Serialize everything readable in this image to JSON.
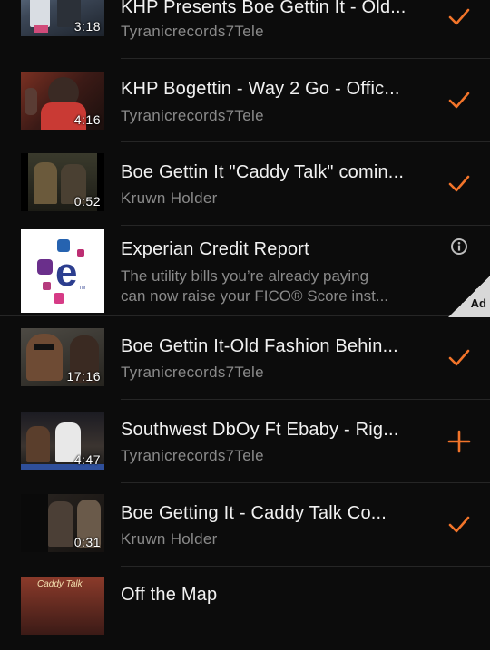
{
  "accent_color": "#f2742a",
  "videos": [
    {
      "title": "KHP Presents Boe Gettin It - Old...",
      "channel": "Tyranicrecords7Tele",
      "duration": "3:18",
      "action_icon": "checkmark-icon"
    },
    {
      "title": "KHP Bogettin - Way 2 Go - Offic...",
      "channel": "Tyranicrecords7Tele",
      "duration": "4:16",
      "action_icon": "checkmark-icon"
    },
    {
      "title": "Boe Gettin It \"Caddy Talk\" comin...",
      "channel": "Kruwn Holder",
      "duration": "0:52",
      "action_icon": "checkmark-icon"
    },
    {
      "title": "Boe Gettin It-Old Fashion Behin...",
      "channel": "Tyranicrecords7Tele",
      "duration": "17:16",
      "action_icon": "checkmark-icon"
    },
    {
      "title": "Southwest DbOy Ft  Ebaby - Rig...",
      "channel": "Tyranicrecords7Tele",
      "duration": "4:47",
      "action_icon": "plus-icon"
    },
    {
      "title": "Boe Getting It  - Caddy Talk Co...",
      "channel": "Kruwn Holder",
      "duration": "0:31",
      "action_icon": "checkmark-icon"
    },
    {
      "title": "Off the Map",
      "channel": "",
      "duration": "",
      "action_icon": ""
    }
  ],
  "ad": {
    "title": "Experian Credit Report",
    "description_line1": "The utility bills you’re already paying",
    "description_line2": "can now raise your FICO® Score inst...",
    "badge": "Ad",
    "logo_letter": "e",
    "logo_tm": "TM",
    "info_icon": "info-icon"
  },
  "thumb_text": {
    "caddy_talk": "Caddy Talk"
  }
}
